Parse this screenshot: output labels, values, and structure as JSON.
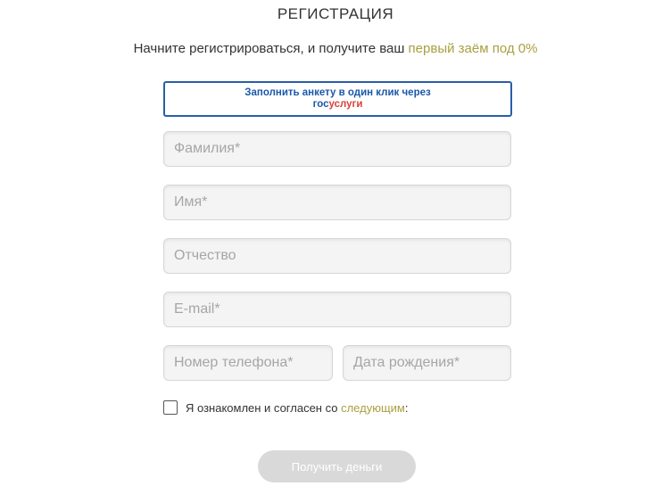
{
  "header": {
    "title": "РЕГИСТРАЦИЯ",
    "subtitle_prefix": "Начните регистрироваться, и получите ваш ",
    "subtitle_accent": "первый заём под 0%"
  },
  "gosuslugi_button": {
    "label": "Заполнить анкету в один клик через",
    "logo_part1": "гос",
    "logo_part2": "услуги"
  },
  "form": {
    "last_name": {
      "placeholder": "Фамилия*",
      "value": ""
    },
    "first_name": {
      "placeholder": "Имя*",
      "value": ""
    },
    "middle_name": {
      "placeholder": "Отчество",
      "value": ""
    },
    "email": {
      "placeholder": "E-mail*",
      "value": ""
    },
    "phone": {
      "placeholder": "Номер телефона*",
      "value": ""
    },
    "birth_date": {
      "placeholder": "Дата рождения*",
      "value": ""
    }
  },
  "agreement": {
    "text": "Я ознакомлен и согласен со ",
    "link": "следующим",
    "suffix": ":",
    "checked": false
  },
  "submit": {
    "label": "Получить деньги"
  },
  "colors": {
    "accent": "#a8a041",
    "gos_blue": "#1a58a8",
    "gos_red": "#d8423a",
    "button_disabled": "#d9d9d9"
  }
}
